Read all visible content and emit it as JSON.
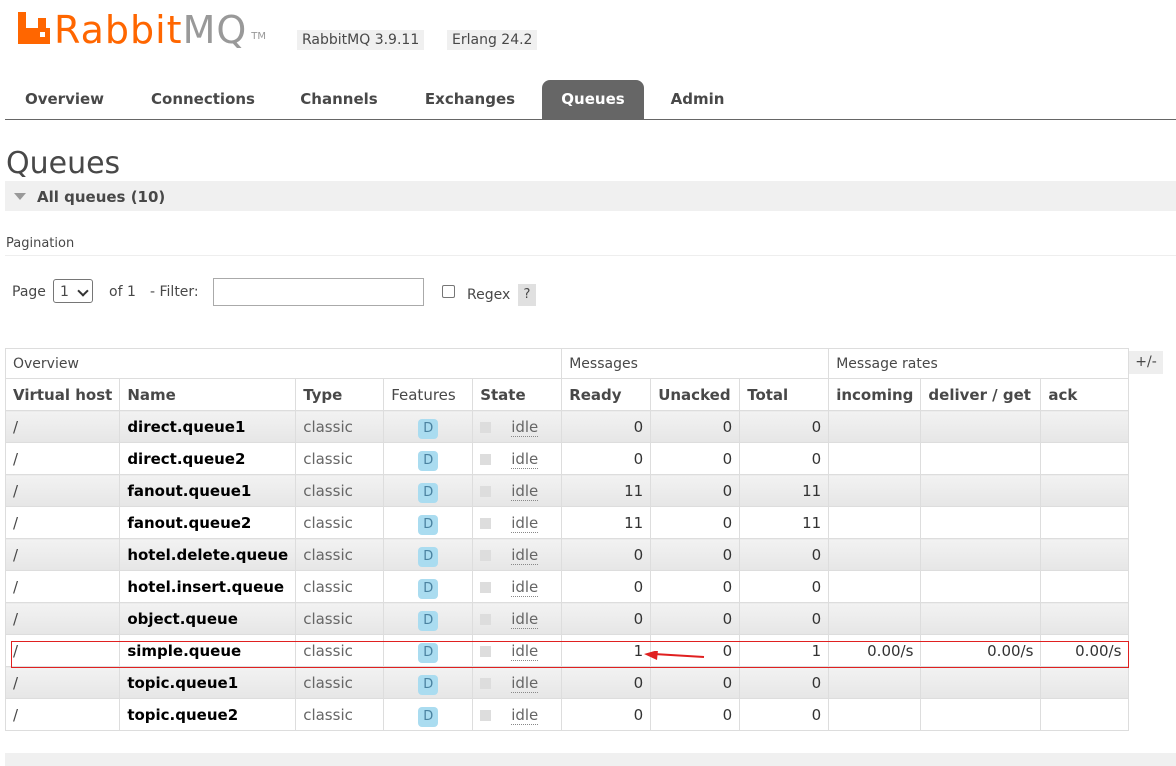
{
  "brand": {
    "name_orange": "Rabbit",
    "name_grey": "MQ",
    "tm": "TM",
    "accent": "#ff6600"
  },
  "versions": {
    "rabbit": "RabbitMQ 3.9.11",
    "erlang": "Erlang 24.2"
  },
  "tabs": [
    "Overview",
    "Connections",
    "Channels",
    "Exchanges",
    "Queues",
    "Admin"
  ],
  "active_tab": "Queues",
  "page_title": "Queues",
  "section": {
    "label": "All queues (10)"
  },
  "pagination": {
    "title": "Pagination",
    "page_label": "Page",
    "page_value": "1",
    "of_label": "of 1",
    "filter_label": "- Filter:",
    "filter_value": "",
    "regex_label": "Regex",
    "help": "?"
  },
  "columns_toggle": "+/-",
  "table": {
    "groups": [
      "Overview",
      "Messages",
      "Message rates"
    ],
    "headers": [
      "Virtual host",
      "Name",
      "Type",
      "Features",
      "State",
      "Ready",
      "Unacked",
      "Total",
      "incoming",
      "deliver / get",
      "ack"
    ],
    "rows": [
      {
        "vhost": "/",
        "name": "direct.queue1",
        "type": "classic",
        "feature": "D",
        "state": "idle",
        "ready": "0",
        "unacked": "0",
        "total": "0",
        "incoming": "",
        "deliver": "",
        "ack": ""
      },
      {
        "vhost": "/",
        "name": "direct.queue2",
        "type": "classic",
        "feature": "D",
        "state": "idle",
        "ready": "0",
        "unacked": "0",
        "total": "0",
        "incoming": "",
        "deliver": "",
        "ack": ""
      },
      {
        "vhost": "/",
        "name": "fanout.queue1",
        "type": "classic",
        "feature": "D",
        "state": "idle",
        "ready": "11",
        "unacked": "0",
        "total": "11",
        "incoming": "",
        "deliver": "",
        "ack": ""
      },
      {
        "vhost": "/",
        "name": "fanout.queue2",
        "type": "classic",
        "feature": "D",
        "state": "idle",
        "ready": "11",
        "unacked": "0",
        "total": "11",
        "incoming": "",
        "deliver": "",
        "ack": ""
      },
      {
        "vhost": "/",
        "name": "hotel.delete.queue",
        "type": "classic",
        "feature": "D",
        "state": "idle",
        "ready": "0",
        "unacked": "0",
        "total": "0",
        "incoming": "",
        "deliver": "",
        "ack": ""
      },
      {
        "vhost": "/",
        "name": "hotel.insert.queue",
        "type": "classic",
        "feature": "D",
        "state": "idle",
        "ready": "0",
        "unacked": "0",
        "total": "0",
        "incoming": "",
        "deliver": "",
        "ack": ""
      },
      {
        "vhost": "/",
        "name": "object.queue",
        "type": "classic",
        "feature": "D",
        "state": "idle",
        "ready": "0",
        "unacked": "0",
        "total": "0",
        "incoming": "",
        "deliver": "",
        "ack": ""
      },
      {
        "vhost": "/",
        "name": "simple.queue",
        "type": "classic",
        "feature": "D",
        "state": "idle",
        "ready": "1",
        "unacked": "0",
        "total": "1",
        "incoming": "0.00/s",
        "deliver": "0.00/s",
        "ack": "0.00/s"
      },
      {
        "vhost": "/",
        "name": "topic.queue1",
        "type": "classic",
        "feature": "D",
        "state": "idle",
        "ready": "0",
        "unacked": "0",
        "total": "0",
        "incoming": "",
        "deliver": "",
        "ack": ""
      },
      {
        "vhost": "/",
        "name": "topic.queue2",
        "type": "classic",
        "feature": "D",
        "state": "idle",
        "ready": "0",
        "unacked": "0",
        "total": "0",
        "incoming": "",
        "deliver": "",
        "ack": ""
      }
    ]
  },
  "annotation": {
    "color": "#e02020",
    "highlighted_row": "simple.queue"
  }
}
